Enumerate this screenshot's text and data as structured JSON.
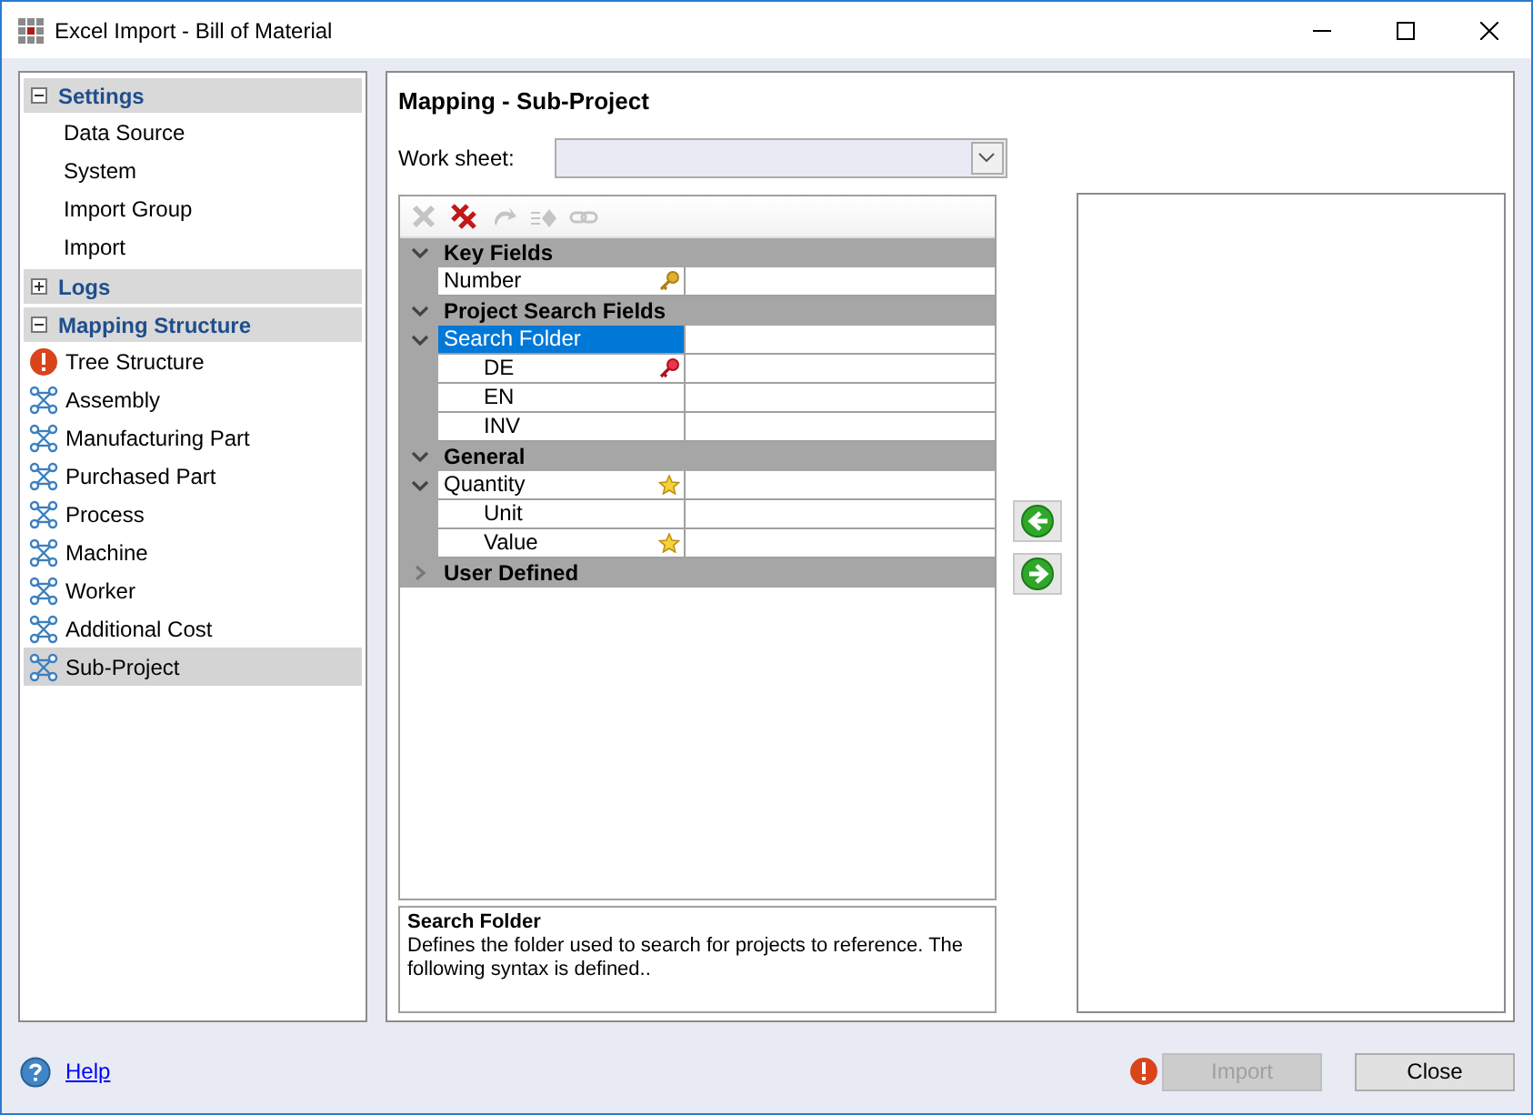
{
  "window": {
    "title": "Excel Import - Bill of Material"
  },
  "sidebar": {
    "groups": [
      {
        "label": "Settings",
        "expanded": true,
        "items": [
          {
            "label": "Data Source",
            "kind": "plain",
            "selected": false
          },
          {
            "label": "System",
            "kind": "plain",
            "selected": false
          },
          {
            "label": "Import Group",
            "kind": "plain",
            "selected": false
          },
          {
            "label": "Import",
            "kind": "plain",
            "selected": false
          }
        ]
      },
      {
        "label": "Logs",
        "expanded": false
      },
      {
        "label": "Mapping Structure",
        "expanded": true,
        "items": [
          {
            "label": "Tree Structure",
            "kind": "error",
            "selected": false
          },
          {
            "label": "Assembly",
            "kind": "mapping",
            "selected": false
          },
          {
            "label": "Manufacturing Part",
            "kind": "mapping",
            "selected": false
          },
          {
            "label": "Purchased Part",
            "kind": "mapping",
            "selected": false
          },
          {
            "label": "Process",
            "kind": "mapping",
            "selected": false
          },
          {
            "label": "Machine",
            "kind": "mapping",
            "selected": false
          },
          {
            "label": "Worker",
            "kind": "mapping",
            "selected": false
          },
          {
            "label": "Additional Cost",
            "kind": "mapping",
            "selected": false
          },
          {
            "label": "Sub-Project",
            "kind": "mapping",
            "selected": true
          }
        ]
      }
    ]
  },
  "main": {
    "title": "Mapping - Sub-Project",
    "worksheet": {
      "label": "Work sheet:"
    },
    "toolbar": [
      {
        "kind": "delete",
        "disabled": true
      },
      {
        "kind": "delete-all",
        "disabled": false
      },
      {
        "kind": "undo",
        "disabled": true
      },
      {
        "kind": "assign",
        "disabled": true
      },
      {
        "kind": "link",
        "disabled": true
      }
    ],
    "grid": {
      "sections": [
        {
          "label": "Key Fields",
          "expanded": true,
          "fields": [
            {
              "label": "Number",
              "kind": "key",
              "selected": false
            }
          ]
        },
        {
          "label": "Project Search Fields",
          "expanded": true,
          "fields": [
            {
              "label": "Search Folder",
              "kind": "plain",
              "selected": true,
              "expanded": true,
              "children": [
                {
                  "label": "DE",
                  "kind": "mandatory",
                  "selected": false
                },
                {
                  "label": "EN",
                  "kind": "plain",
                  "selected": false
                },
                {
                  "label": "INV",
                  "kind": "plain",
                  "selected": false
                }
              ]
            }
          ]
        },
        {
          "label": "General",
          "expanded": true,
          "fields": [
            {
              "label": "Quantity",
              "kind": "star",
              "selected": false,
              "expanded": true,
              "children": [
                {
                  "label": "Unit",
                  "kind": "plain",
                  "selected": false
                },
                {
                  "label": "Value",
                  "kind": "star",
                  "selected": false
                }
              ]
            }
          ]
        },
        {
          "label": "User Defined",
          "expanded": false
        }
      ]
    },
    "description": {
      "title": "Search Folder",
      "text": "Defines the folder used to search for projects to reference. The following syntax is defined.."
    },
    "move_buttons": [
      {
        "kind": "left"
      },
      {
        "kind": "right"
      }
    ]
  },
  "footer": {
    "help": "Help",
    "error_indicator": true,
    "buttons": [
      {
        "label": "Import",
        "disabled": true
      },
      {
        "label": "Close",
        "disabled": false
      }
    ]
  }
}
